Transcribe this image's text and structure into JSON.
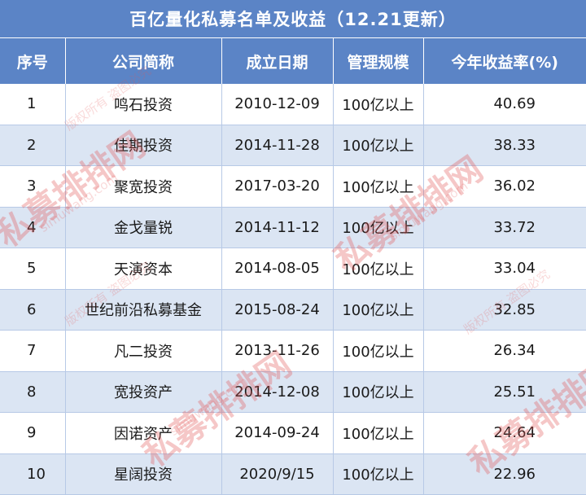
{
  "title": "百亿量化私募名单及收益（12.21更新）",
  "headers": [
    "序号",
    "公司简称",
    "成立日期",
    "管理规模",
    "今年收益率(%)"
  ],
  "rows": [
    {
      "rank": "1",
      "name": "鸣石投资",
      "date": "2010-12-09",
      "scale": "100亿以上",
      "return": "40.69"
    },
    {
      "rank": "2",
      "name": "佳期投资",
      "date": "2014-11-28",
      "scale": "100亿以上",
      "return": "38.33"
    },
    {
      "rank": "3",
      "name": "聚宽投资",
      "date": "2017-03-20",
      "scale": "100亿以上",
      "return": "36.02"
    },
    {
      "rank": "4",
      "name": "金戈量锐",
      "date": "2014-11-12",
      "scale": "100亿以上",
      "return": "33.72"
    },
    {
      "rank": "5",
      "name": "天演资本",
      "date": "2014-08-05",
      "scale": "100亿以上",
      "return": "33.04"
    },
    {
      "rank": "6",
      "name": "世纪前沿私募基金",
      "date": "2015-08-24",
      "scale": "100亿以上",
      "return": "32.85"
    },
    {
      "rank": "7",
      "name": "凡二投资",
      "date": "2013-11-26",
      "scale": "100亿以上",
      "return": "26.34"
    },
    {
      "rank": "8",
      "name": "宽投资产",
      "date": "2014-12-08",
      "scale": "100亿以上",
      "return": "25.51"
    },
    {
      "rank": "9",
      "name": "因诺资产",
      "date": "2014-09-24",
      "scale": "100亿以上",
      "return": "24.64"
    },
    {
      "rank": "10",
      "name": "星阔投资",
      "date": "2020/9/15",
      "scale": "100亿以上",
      "return": "22.96"
    }
  ],
  "watermark": {
    "brand": "私募排排网",
    "url": "simuwang.com",
    "notice": "版权所有 盗图必究",
    "color": "#e25656"
  },
  "colors": {
    "header_bg": "#5b84c6",
    "stripe_bg": "#dbe5f3",
    "border": "#b7c9e6"
  }
}
